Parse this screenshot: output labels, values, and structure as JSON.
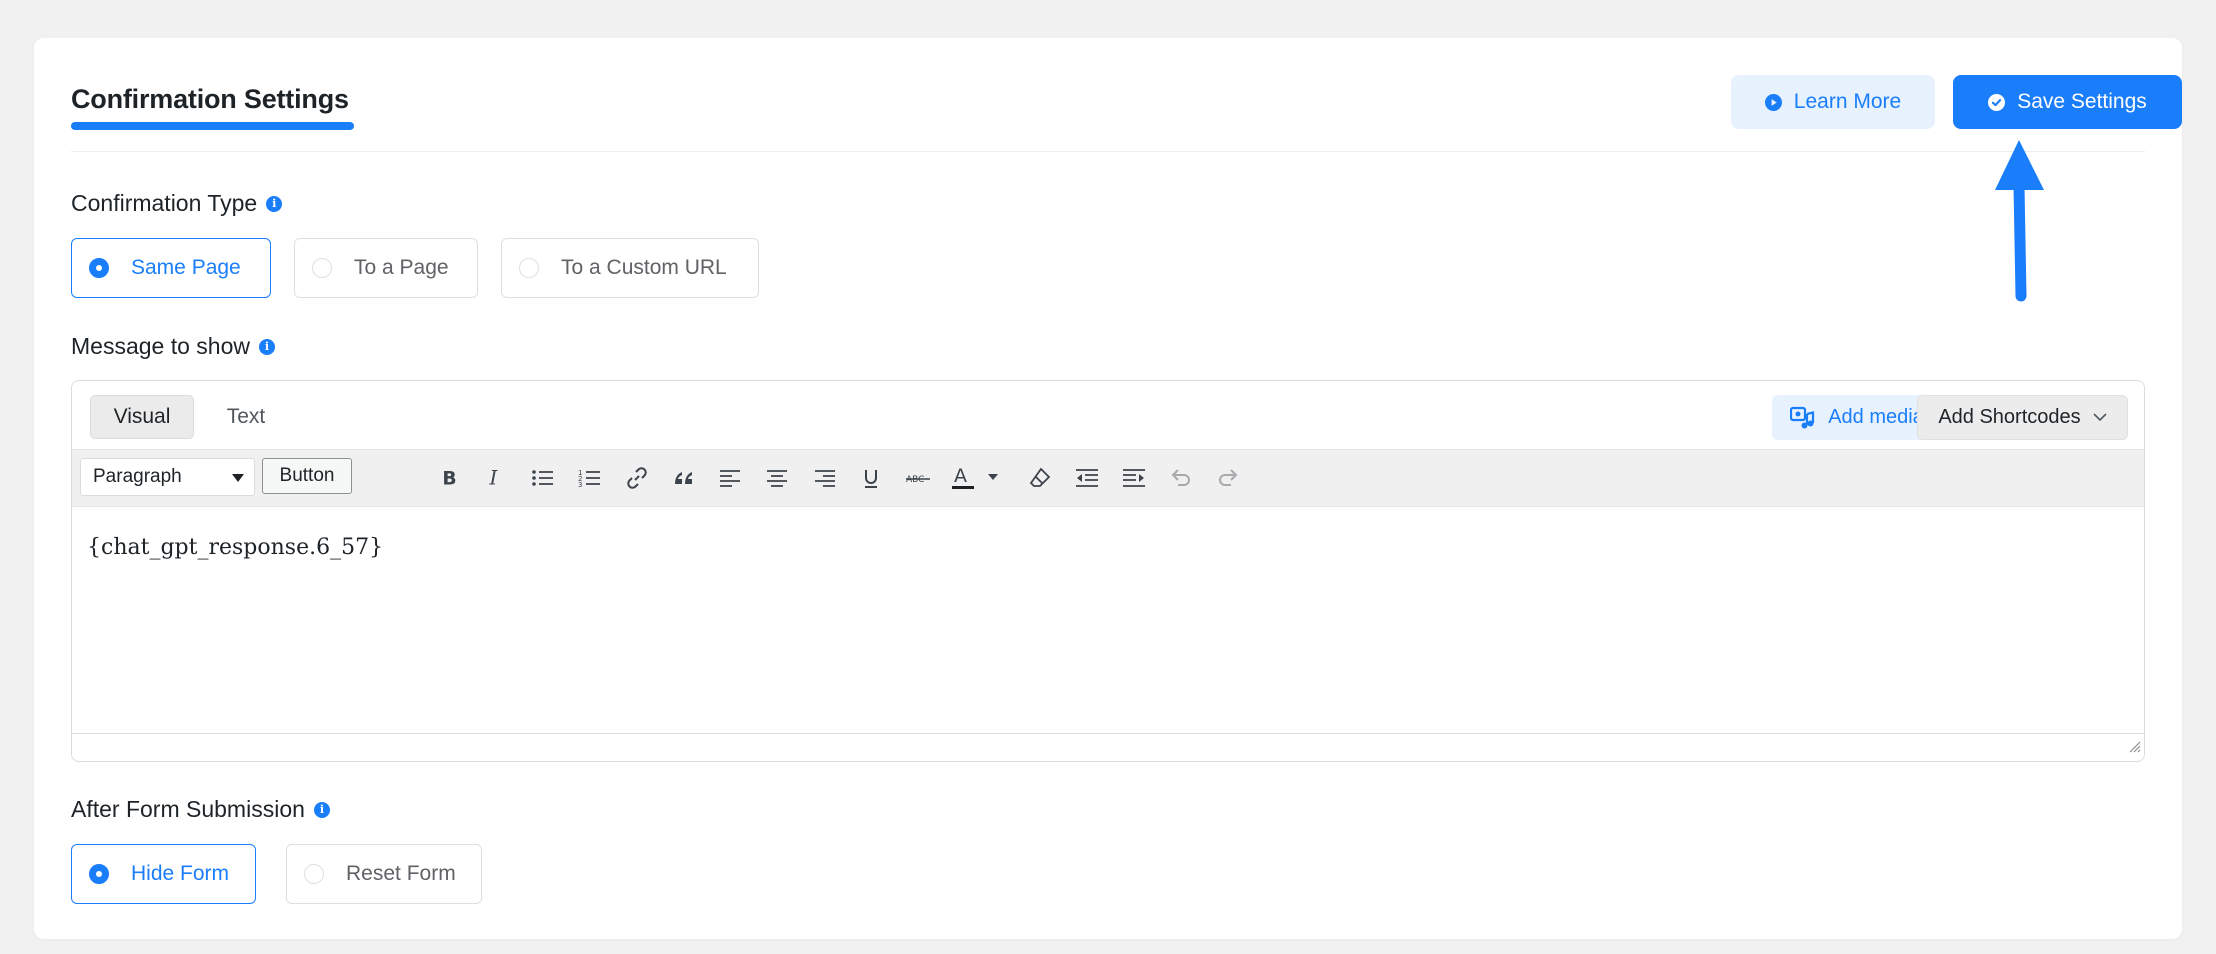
{
  "header": {
    "title": "Confirmation Settings",
    "learn_more_label": "Learn More",
    "save_label": "Save Settings"
  },
  "confirmation_type": {
    "label": "Confirmation Type",
    "options": [
      {
        "label": "Same Page",
        "selected": true
      },
      {
        "label": "To a Page",
        "selected": false
      },
      {
        "label": "To a Custom URL",
        "selected": false
      }
    ]
  },
  "message": {
    "label": "Message to show",
    "tabs": [
      {
        "label": "Visual",
        "active": true
      },
      {
        "label": "Text",
        "active": false
      }
    ],
    "add_media_label": "Add media",
    "add_shortcodes_label": "Add Shortcodes",
    "format_select": "Paragraph",
    "button_label": "Button",
    "toolbar_icons": [
      "bold-icon",
      "italic-icon",
      "bulleted-list-icon",
      "numbered-list-icon",
      "link-icon",
      "blockquote-icon",
      "align-left-icon",
      "align-center-icon",
      "align-right-icon",
      "underline-icon",
      "strikethrough-icon",
      "text-color-icon",
      "clear-formatting-icon",
      "outdent-icon",
      "indent-icon",
      "undo-icon",
      "redo-icon"
    ],
    "content": "{chat_gpt_response.6_57}"
  },
  "after_submission": {
    "label": "After Form Submission",
    "options": [
      {
        "label": "Hide Form",
        "selected": true
      },
      {
        "label": "Reset Form",
        "selected": false
      }
    ]
  },
  "colors": {
    "accent": "#1a7efb",
    "accent_light": "#e8f2ff",
    "background": "#f1f1f1"
  }
}
